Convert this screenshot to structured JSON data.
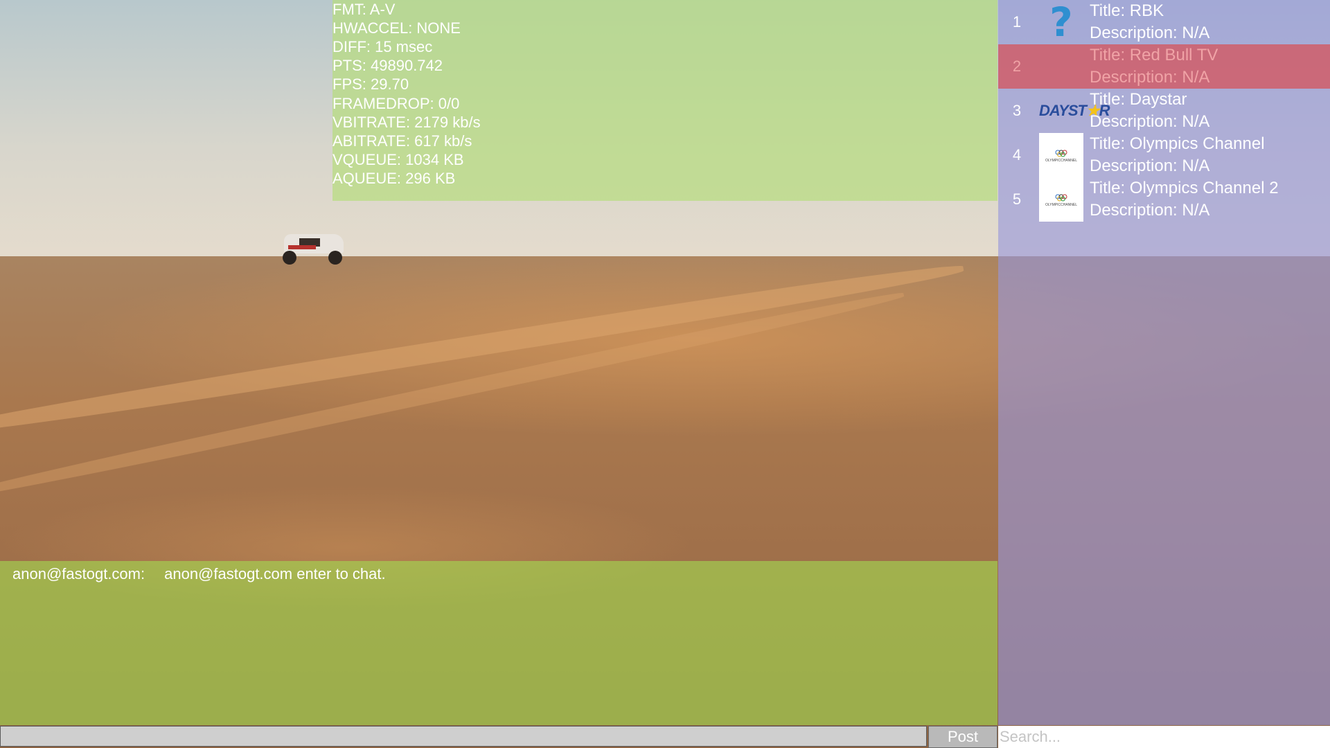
{
  "stats": {
    "fmt": "FMT: A-V",
    "hwaccel": "HWACCEL: NONE",
    "diff": "DIFF: 15 msec",
    "pts": "PTS: 49890.742",
    "fps": "FPS: 29.70",
    "framedrop": "FRAMEDROP: 0/0",
    "vbitrate": "VBITRATE: 2179 kb/s",
    "abitrate": "ABITRATE: 617 kb/s",
    "vqueue": "VQUEUE: 1034 KB",
    "aqueue": "AQUEUE: 296 KB"
  },
  "chat": {
    "user": "anon@fastogt.com:",
    "message": "anon@fastogt.com enter to chat.",
    "post_label": "Post"
  },
  "search": {
    "placeholder": "Search..."
  },
  "channels": [
    {
      "number": "1",
      "title": "Title: RBK",
      "description": "Description: N/A",
      "logo": "question-mark-icon",
      "selected": false
    },
    {
      "number": "2",
      "title": "Title: Red Bull TV",
      "description": "Description: N/A",
      "logo": "none",
      "selected": true
    },
    {
      "number": "3",
      "title": "Title: Daystar",
      "description": "Description: N/A",
      "logo": "daystar-logo",
      "selected": false
    },
    {
      "number": "4",
      "title": "Title: Olympics Channel",
      "description": "Description: N/A",
      "logo": "olympic-channel-logo",
      "selected": false
    },
    {
      "number": "5",
      "title": "Title: Olympics Channel 2",
      "description": "Description: N/A",
      "logo": "olympic-channel-logo",
      "selected": false
    }
  ],
  "logos": {
    "daystar_prefix": "DAYST",
    "daystar_star": "★",
    "daystar_suffix": "R",
    "olympic_text": "OLYMPICCHANNEL"
  },
  "colors": {
    "stats_panel": "#b7dd80",
    "chat_panel": "#a3da50",
    "channel_panel": "#9696dc",
    "selected_row": "#d25a64"
  }
}
